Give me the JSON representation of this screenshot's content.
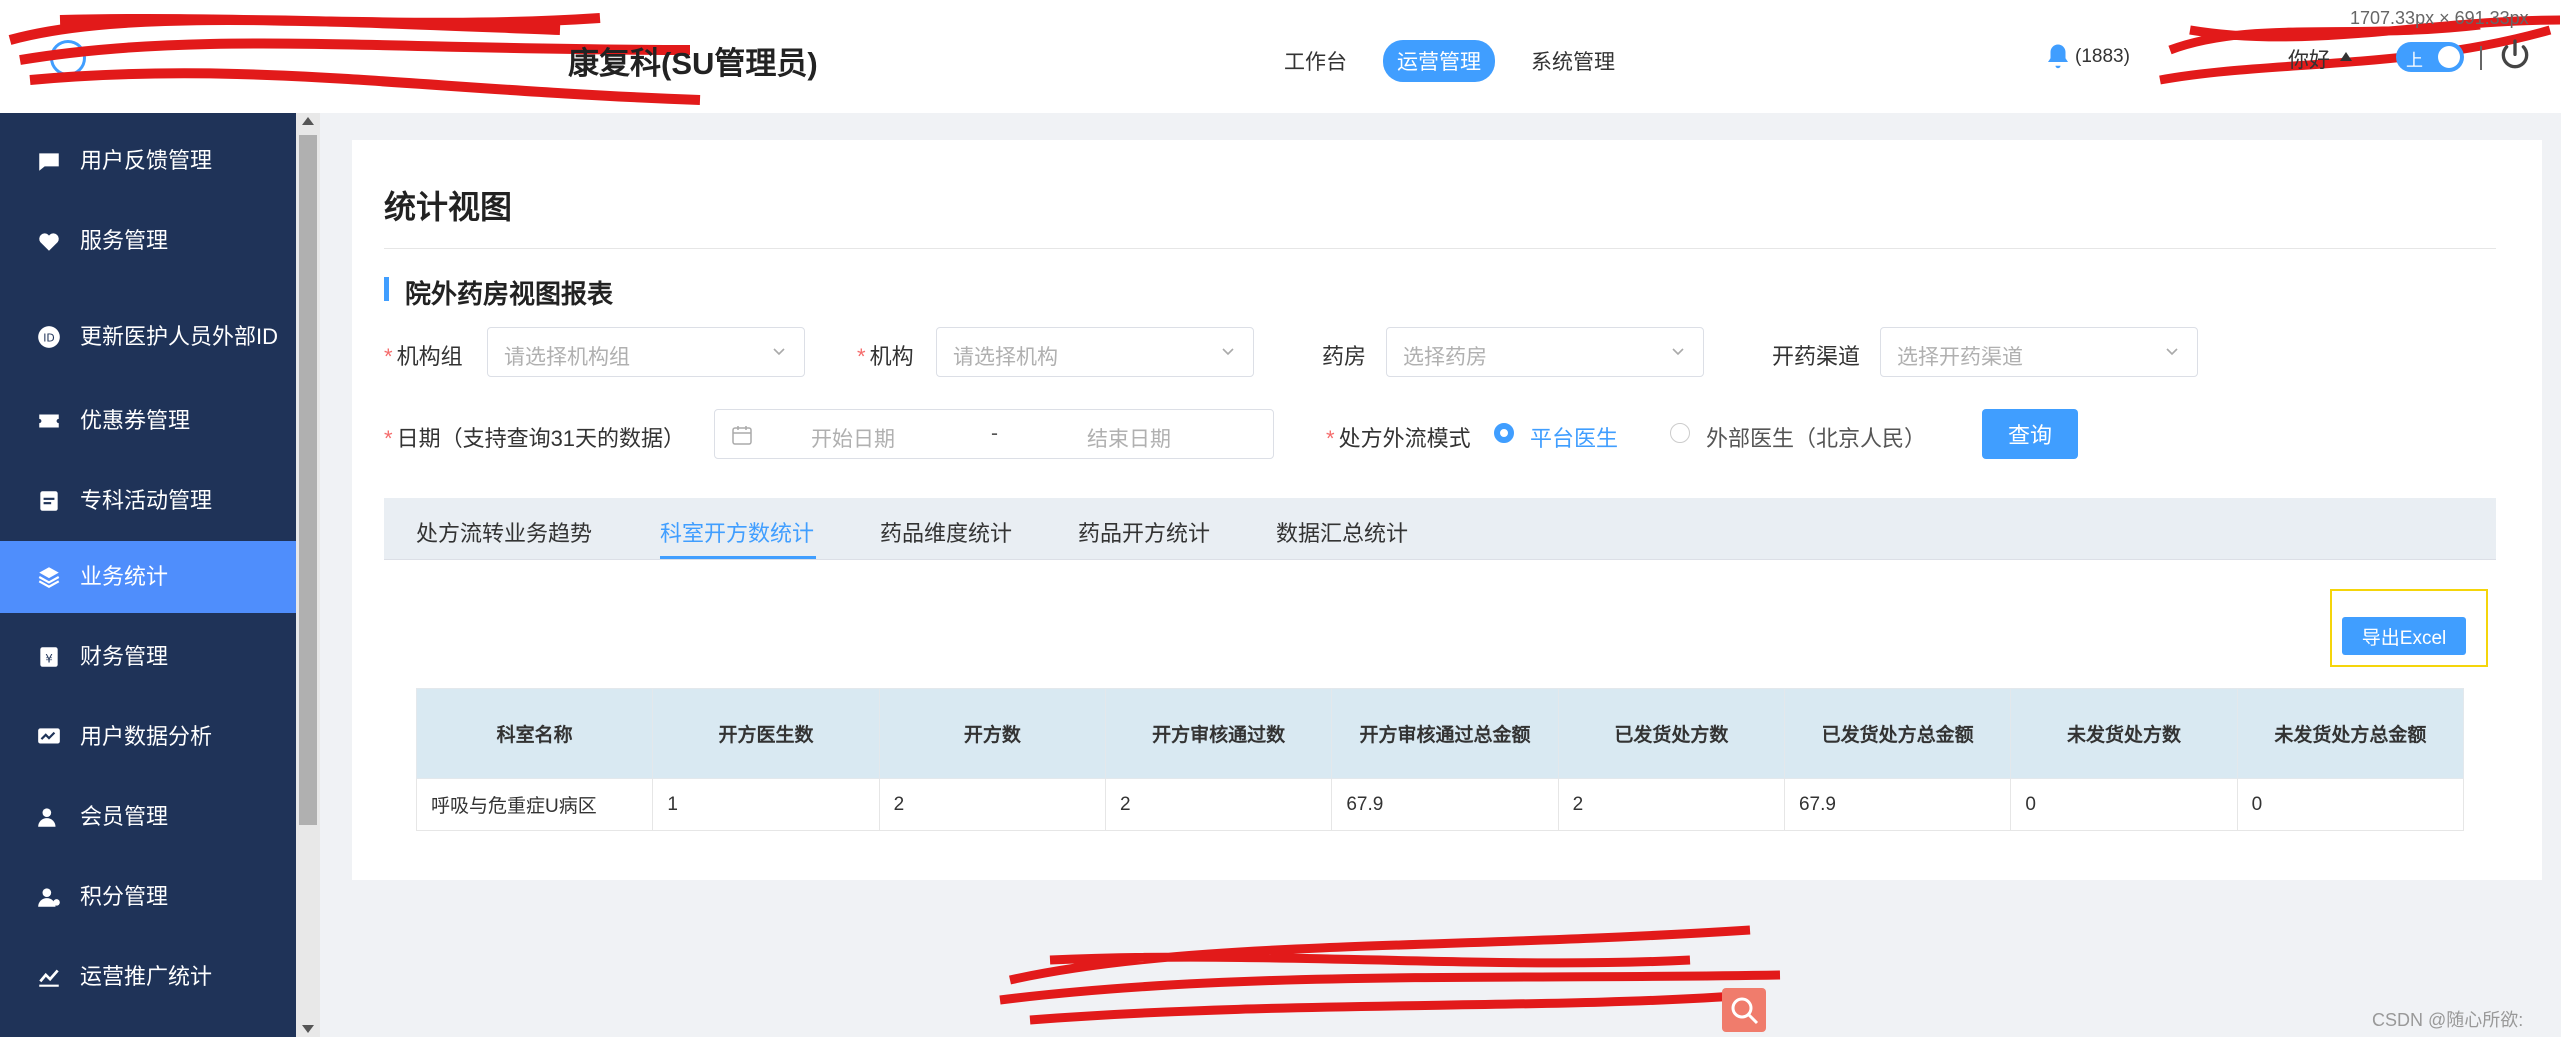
{
  "header": {
    "title": "康复科(SU管理员)",
    "nav": [
      "工作台",
      "运营管理",
      "系统管理"
    ],
    "active_nav": 1,
    "notification_count": "(1883)",
    "greeting": "你好",
    "toggle_label": "上",
    "size_readout": "1707.33px × 691.33px"
  },
  "sidebar": {
    "items": [
      {
        "label": "用户反馈管理",
        "icon": "feedback-icon"
      },
      {
        "label": "服务管理",
        "icon": "heart-icon"
      },
      {
        "label": "更新医护人员外部ID",
        "icon": "id-icon"
      },
      {
        "label": "优惠券管理",
        "icon": "coupon-icon"
      },
      {
        "label": "专科活动管理",
        "icon": "activity-icon"
      },
      {
        "label": "业务统计",
        "icon": "layers-icon"
      },
      {
        "label": "财务管理",
        "icon": "finance-icon"
      },
      {
        "label": "用户数据分析",
        "icon": "analysis-icon"
      },
      {
        "label": "会员管理",
        "icon": "member-icon"
      },
      {
        "label": "积分管理",
        "icon": "points-icon"
      },
      {
        "label": "运营推广统计",
        "icon": "chart-icon"
      }
    ],
    "active_index": 5
  },
  "page": {
    "title": "统计视图",
    "section_title": "院外药房视图报表"
  },
  "filters": {
    "org_group_label": "机构组",
    "org_group_placeholder": "请选择机构组",
    "org_label": "机构",
    "org_placeholder": "请选择机构",
    "pharmacy_label": "药房",
    "pharmacy_placeholder": "选择药房",
    "channel_label": "开药渠道",
    "channel_placeholder": "选择开药渠道",
    "date_label": "日期（支持查询31天的数据）",
    "date_start_placeholder": "开始日期",
    "date_separator": "-",
    "date_end_placeholder": "结束日期",
    "mode_label": "处方外流模式",
    "mode_option_1": "平台医生",
    "mode_option_2": "外部医生（北京人民）",
    "query_label": "查询"
  },
  "tabs": [
    "处方流转业务趋势",
    "科室开方数统计",
    "药品维度统计",
    "药品开方统计",
    "数据汇总统计"
  ],
  "active_tab": 1,
  "export_label": "导出Excel",
  "table": {
    "columns": [
      "科室名称",
      "开方医生数",
      "开方数",
      "开方审核通过数",
      "开方审核通过总金额",
      "已发货处方数",
      "已发货处方总金额",
      "未发货处方数",
      "未发货处方总金额"
    ],
    "rows": [
      [
        "呼吸与危重症U病区",
        "1",
        "2",
        "2",
        "67.9",
        "2",
        "67.9",
        "0",
        "0"
      ]
    ]
  },
  "watermark": "CSDN @随心所欲:",
  "colors": {
    "primary": "#409eff",
    "sidebar_bg": "#1f3358",
    "sidebar_active": "#4f8efc",
    "required": "#f56c6c",
    "highlight_frame": "#f5d50a"
  }
}
